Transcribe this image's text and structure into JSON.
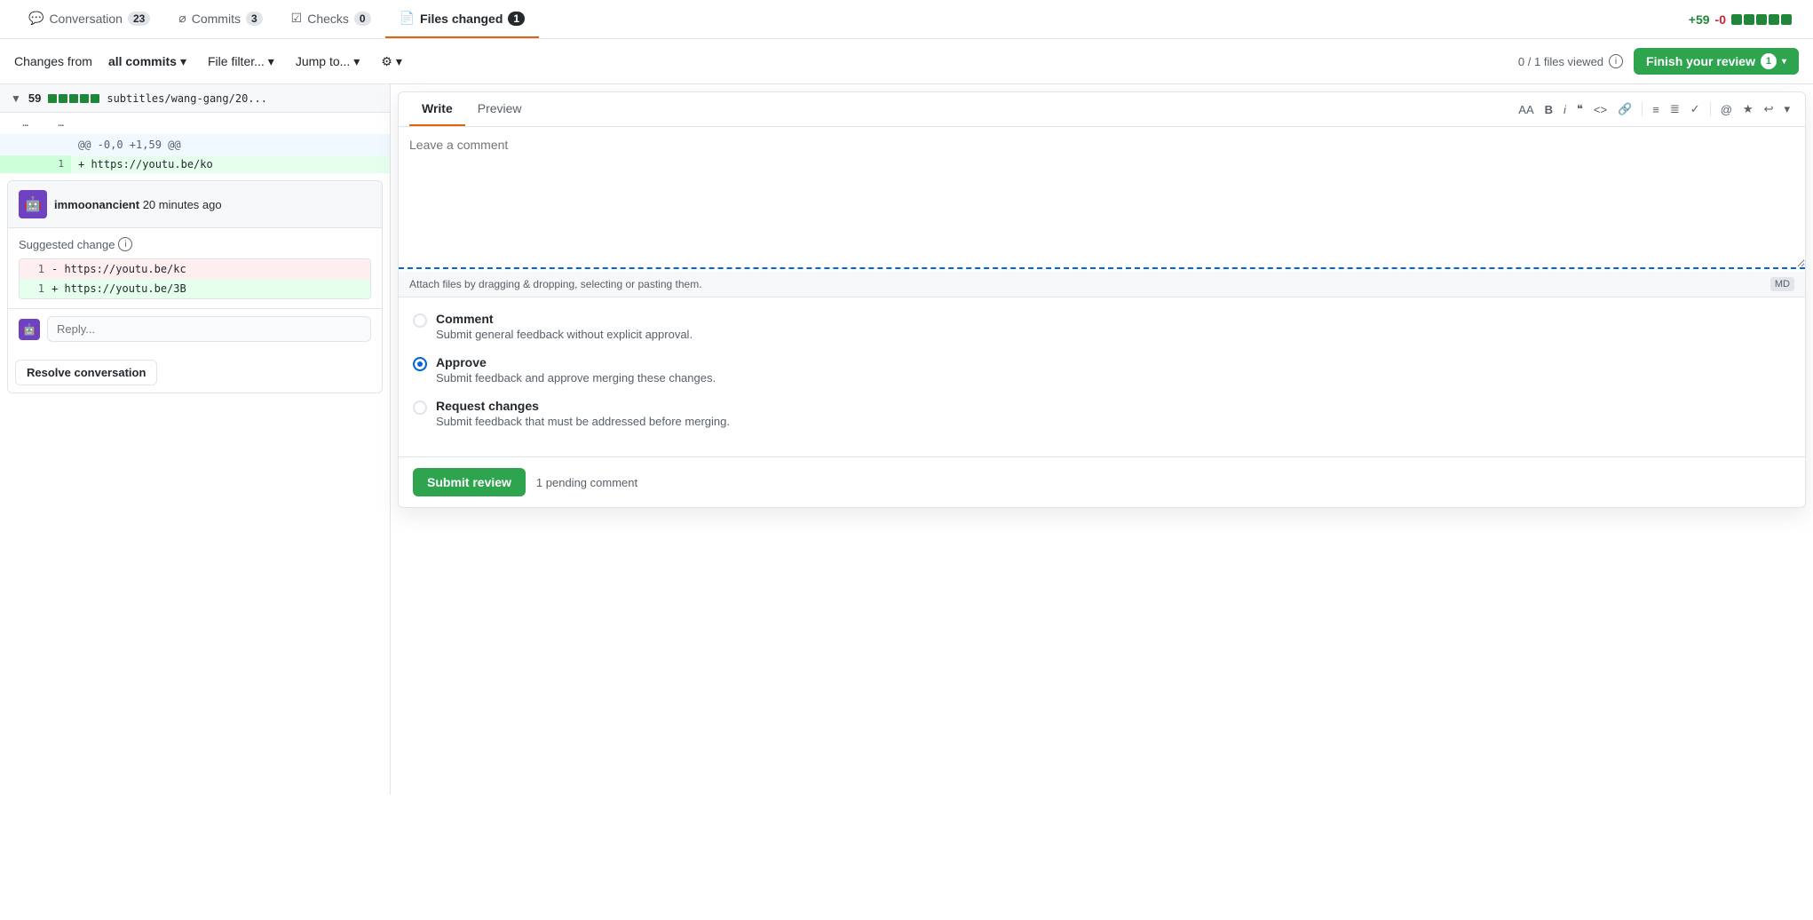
{
  "tabs": [
    {
      "id": "conversation",
      "label": "Conversation",
      "badge": "23",
      "icon": "💬",
      "active": false
    },
    {
      "id": "commits",
      "label": "Commits",
      "badge": "3",
      "icon": "◎",
      "active": false
    },
    {
      "id": "checks",
      "label": "Checks",
      "badge": "0",
      "icon": "☑",
      "active": false
    },
    {
      "id": "files-changed",
      "label": "Files changed",
      "badge": "1",
      "icon": "📄",
      "active": true
    }
  ],
  "diff_stats": {
    "additions": "+59",
    "deletions": "-0",
    "squares": [
      "green",
      "green",
      "green",
      "green",
      "green"
    ]
  },
  "toolbar": {
    "changes_from": "Changes from",
    "all_commits": "all commits",
    "file_filter": "File filter...",
    "jump_to": "Jump to...",
    "gear": "⚙",
    "files_viewed": "0 / 1 files viewed",
    "finish_review": "Finish your review",
    "finish_badge": "1"
  },
  "file": {
    "count": "59",
    "path": "subtitles/wang-gang/20...",
    "hunk": "@@ -0,0 +1,59 @@",
    "lines": [
      {
        "num": "1",
        "code": "+ https://youtu.be/ko",
        "type": "add"
      }
    ]
  },
  "comment": {
    "author": "immoonancient",
    "time": "20 minutes ago",
    "suggested_label": "Suggested change",
    "remove_num": "1",
    "remove_code": "- https://youtu.be/kc",
    "add_num": "1",
    "add_code": "+ https://youtu.be/3B"
  },
  "reply_placeholder": "Reply...",
  "resolve_btn": "Resolve conversation",
  "review_dialog": {
    "write_tab": "Write",
    "preview_tab": "Preview",
    "format_buttons": [
      "AA",
      "B",
      "i",
      "❝",
      "<>",
      "🔗",
      "≡",
      "≣",
      "✓≡",
      "@",
      "★",
      "↩"
    ],
    "textarea_placeholder": "Leave a comment",
    "attach_text": "Attach files by dragging & dropping, selecting or pasting them.",
    "md_label": "MD",
    "options": [
      {
        "id": "comment",
        "label": "Comment",
        "desc": "Submit general feedback without explicit approval.",
        "checked": false
      },
      {
        "id": "approve",
        "label": "Approve",
        "desc": "Submit feedback and approve merging these changes.",
        "checked": true
      },
      {
        "id": "request-changes",
        "label": "Request changes",
        "desc": "Submit feedback that must be addressed before merging.",
        "checked": false
      }
    ],
    "submit_label": "Submit review",
    "pending_text": "1 pending comment"
  }
}
